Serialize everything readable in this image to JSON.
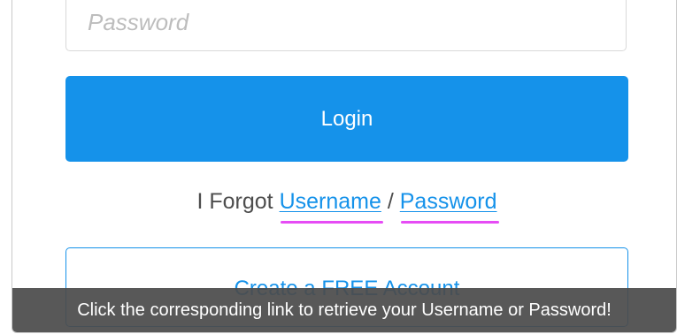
{
  "form": {
    "password_placeholder": "Password",
    "password_value": "",
    "login_label": "Login",
    "forgot_prefix": "I Forgot ",
    "forgot_username_link": "Username",
    "forgot_separator": " / ",
    "forgot_password_link": "Password",
    "create_account_label": "Create a FREE Account"
  },
  "tooltip": {
    "text": "Click the corresponding link to retrieve your Username or Password!"
  },
  "colors": {
    "primary": "#1592ea",
    "annotation_underline": "#e64cf5",
    "tooltip_background": "#4b4b4b",
    "body_text": "#4d4d4d"
  }
}
